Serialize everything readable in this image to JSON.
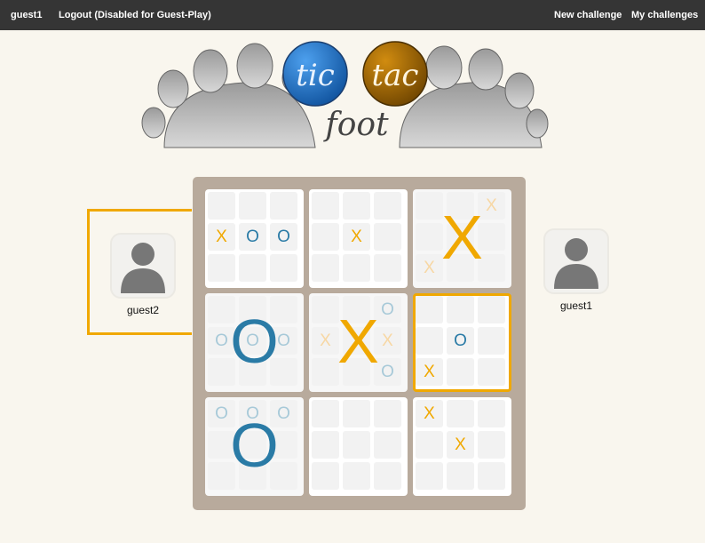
{
  "topbar": {
    "username": "guest1",
    "logout_label": "Logout (Disabled for Guest-Play)",
    "new_challenge_label": "New challenge",
    "my_challenges_label": "My challenges"
  },
  "logo": {
    "word1": "tic",
    "word2": "tac",
    "word3": "foot",
    "colors": {
      "tic": "#1a6fc2",
      "tac": "#a86d00",
      "feet": "#7a7a7a"
    }
  },
  "players": {
    "left": {
      "name": "guest2",
      "is_current_turn": true
    },
    "right": {
      "name": "guest1"
    }
  },
  "colors": {
    "x": "#f0a800",
    "o": "#2a7ba6",
    "board": "#b8aa9c",
    "highlight": "#f0a800"
  },
  "board": [
    {
      "winner": "",
      "active": false,
      "cells": [
        "",
        "",
        "",
        "X",
        "O",
        "O",
        "",
        "",
        ""
      ]
    },
    {
      "winner": "",
      "active": false,
      "cells": [
        "",
        "",
        "",
        "",
        "X",
        "",
        "",
        "",
        ""
      ]
    },
    {
      "winner": "X",
      "active": false,
      "cells": [
        "",
        "",
        "X",
        "",
        "",
        "",
        "X",
        "",
        ""
      ]
    },
    {
      "winner": "O",
      "active": false,
      "cells": [
        "",
        "",
        "",
        "O",
        "O",
        "O",
        "",
        "",
        ""
      ]
    },
    {
      "winner": "X",
      "active": false,
      "cells": [
        "",
        "",
        "O",
        "X",
        "",
        "X",
        "",
        "",
        "O"
      ]
    },
    {
      "winner": "",
      "active": true,
      "cells": [
        "",
        "",
        "",
        "",
        "O",
        "",
        "X",
        "",
        ""
      ]
    },
    {
      "winner": "O",
      "active": false,
      "cells": [
        "O",
        "O",
        "O",
        "",
        "",
        "",
        "",
        "",
        ""
      ]
    },
    {
      "winner": "",
      "active": false,
      "cells": [
        "",
        "",
        "",
        "",
        "",
        "",
        "",
        "",
        ""
      ]
    },
    {
      "winner": "",
      "active": false,
      "cells": [
        "X",
        "",
        "",
        "",
        "X",
        "",
        "",
        "",
        ""
      ]
    }
  ]
}
